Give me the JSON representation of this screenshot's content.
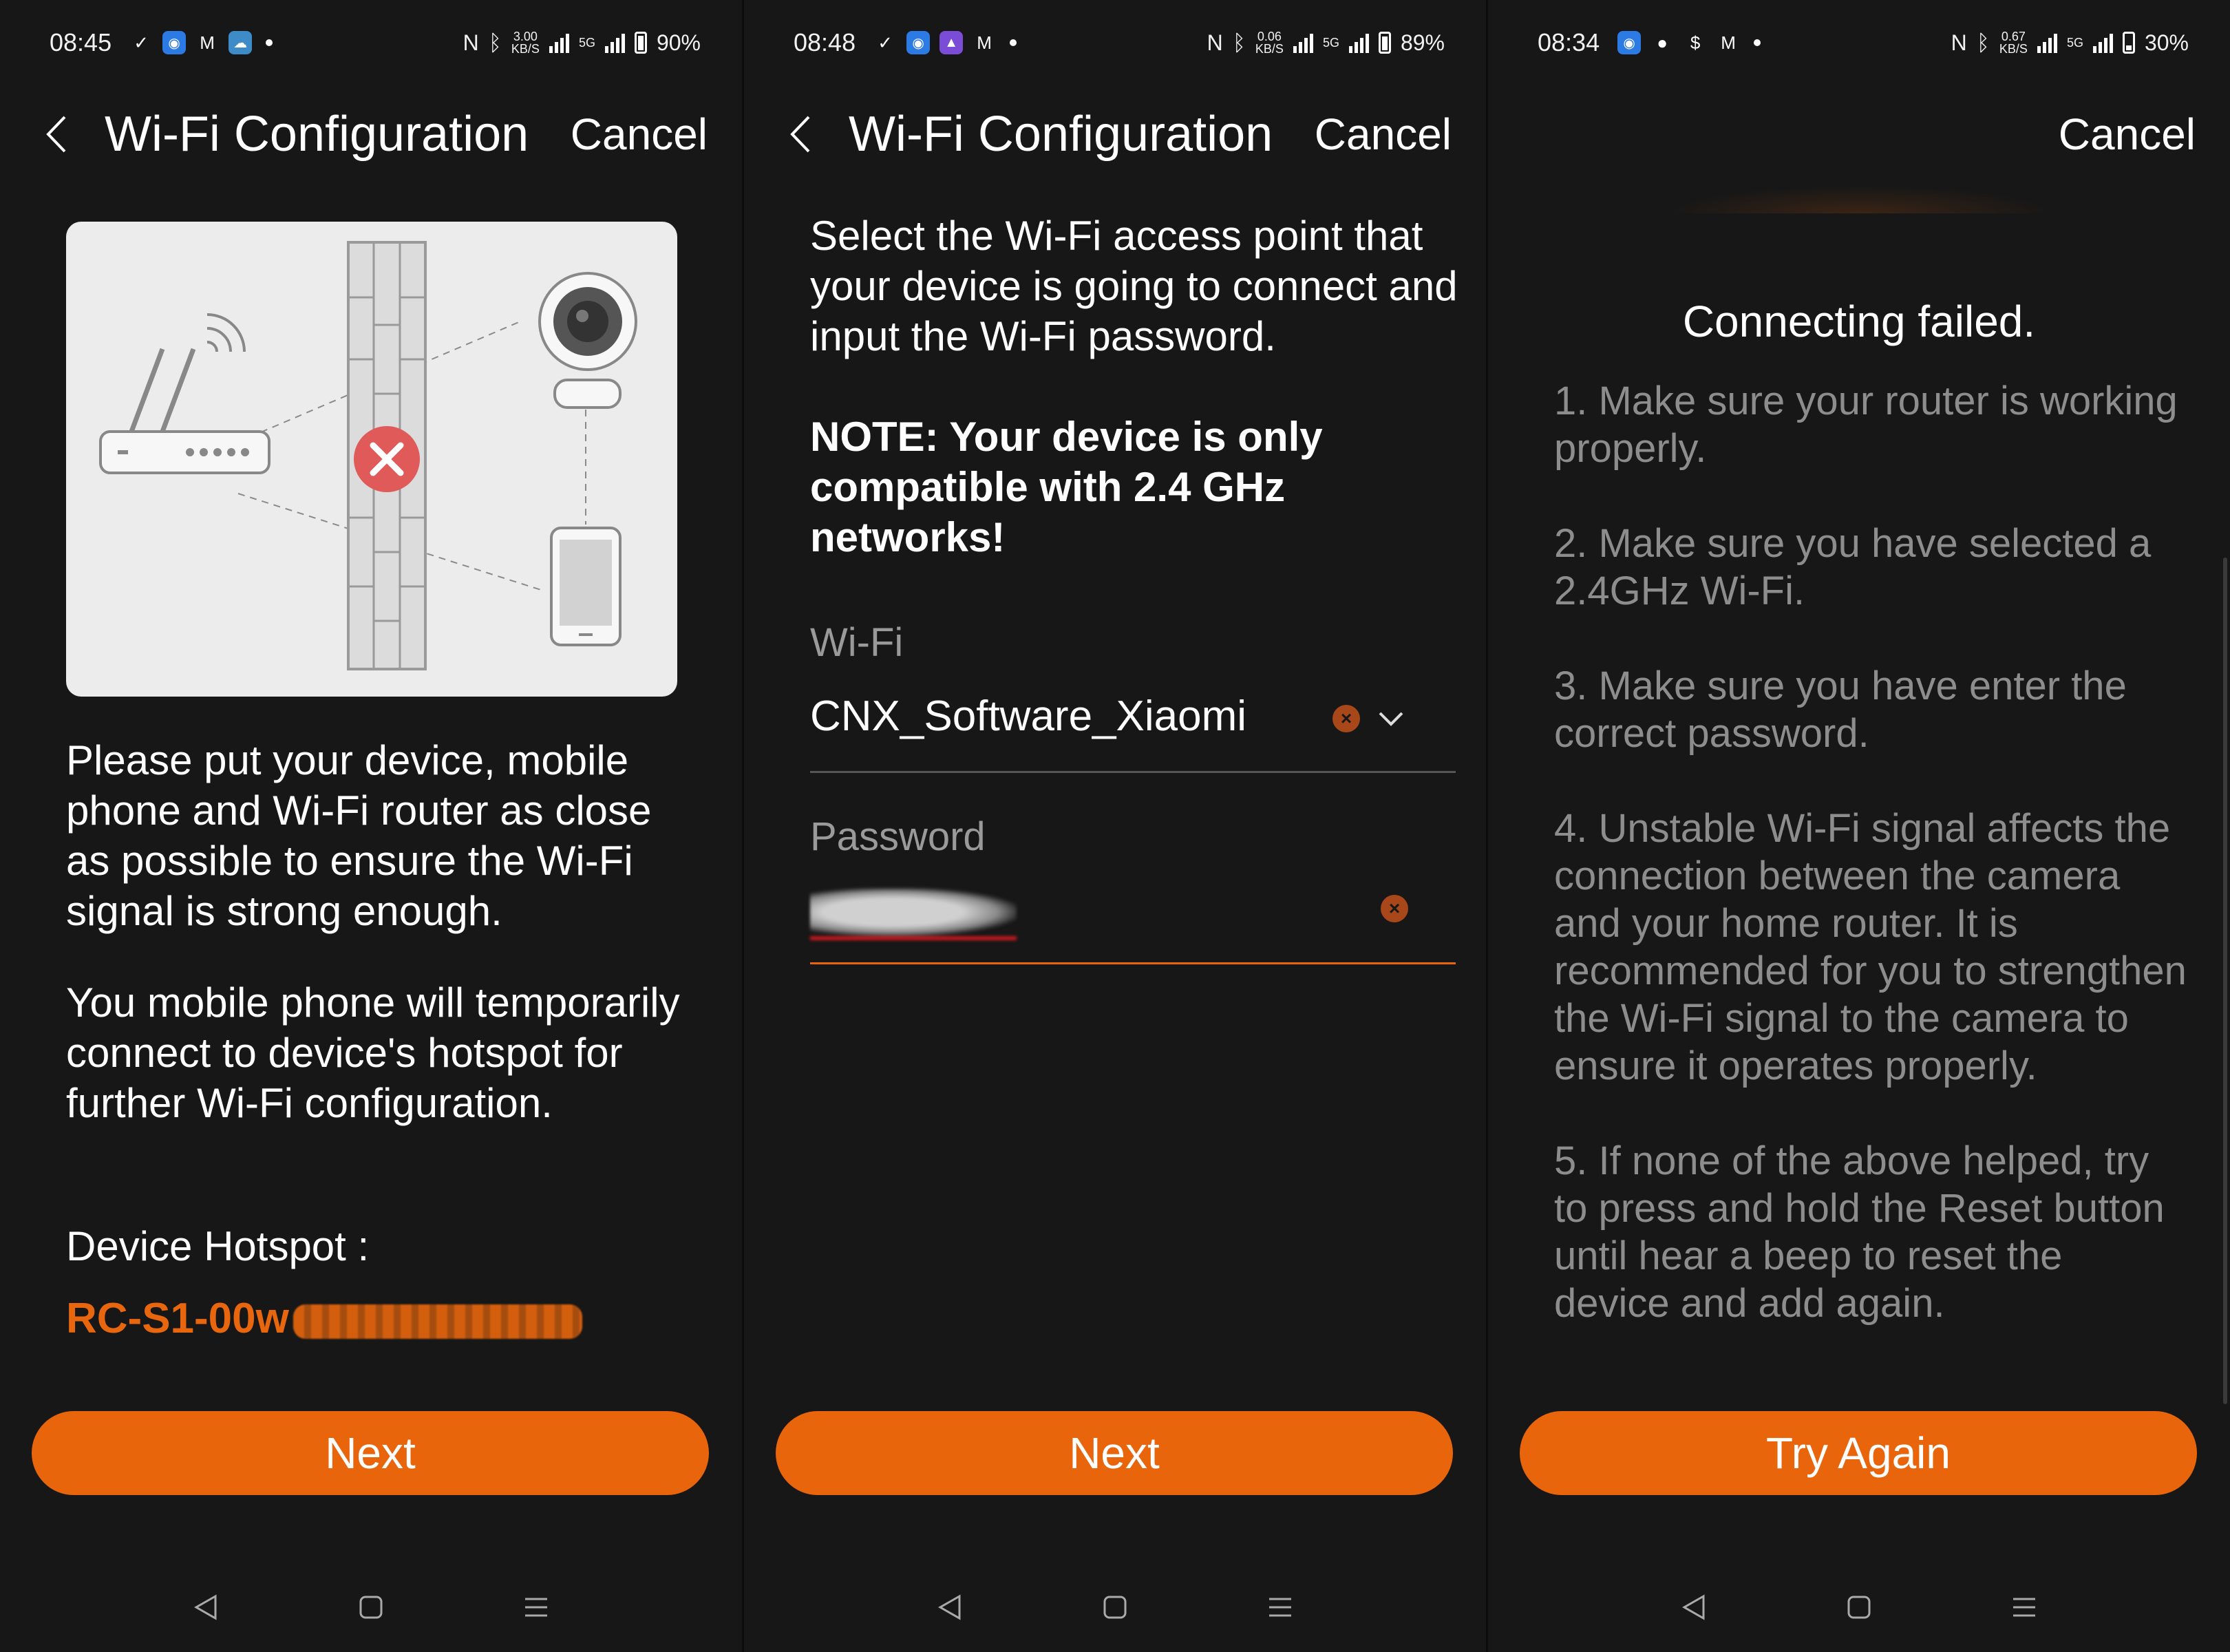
{
  "panels": [
    {
      "status": {
        "time": "08:45",
        "kbs_top": "3.00",
        "kbs_bottom": "KB/S",
        "net": "5G",
        "battery": "90%"
      },
      "header": {
        "title": "Wi-Fi Configuration",
        "cancel": "Cancel"
      },
      "body": {
        "para1": "Please put your device, mobile phone and Wi-Fi router as close as possible to ensure the Wi-Fi signal is strong enough.",
        "para2": "You mobile phone will temporarily connect to device's hotspot for further Wi-Fi configuration.",
        "hotspot_label": "Device Hotspot :",
        "hotspot_value": "RC-S1-00w"
      },
      "button": "Next"
    },
    {
      "status": {
        "time": "08:48",
        "kbs_top": "0.06",
        "kbs_bottom": "KB/S",
        "net": "5G",
        "battery": "89%"
      },
      "header": {
        "title": "Wi-Fi Configuration",
        "cancel": "Cancel"
      },
      "body": {
        "instruction": "Select the Wi-Fi access point that your device is going to connect and input the Wi-Fi password.",
        "note": "NOTE: Your device is only compatible with 2.4 GHz networks!",
        "wifi_label": "Wi-Fi",
        "wifi_value": "CNX_Software_Xiaomi",
        "password_label": "Password"
      },
      "button": "Next"
    },
    {
      "status": {
        "time": "08:34",
        "kbs_top": "0.67",
        "kbs_bottom": "KB/S",
        "net": "5G",
        "battery": "30%"
      },
      "header": {
        "cancel": "Cancel"
      },
      "body": {
        "title": "Connecting failed.",
        "tips": [
          "1. Make sure your router is working properly.",
          "2. Make sure you have selected a 2.4GHz Wi-Fi.",
          "3. Make sure you have enter the correct password.",
          "4. Unstable Wi-Fi signal affects the connection between the camera and your home router. It is recommended for you to strengthen the Wi-Fi signal to the camera to ensure it operates properly.",
          "5. If none of the above helped, try to press and hold the Reset button until hear a beep to reset the device and add again."
        ]
      },
      "button": "Try Again"
    }
  ],
  "colors": {
    "accent": "#e8650b",
    "background": "#171717",
    "muted_text": "#8d8d8d",
    "error_red": "#e05a5a"
  },
  "icons": [
    "back-chevron-icon",
    "clear-icon",
    "dropdown-chevron-icon",
    "nav-back-icon",
    "nav-home-icon",
    "nav-recents-icon"
  ]
}
